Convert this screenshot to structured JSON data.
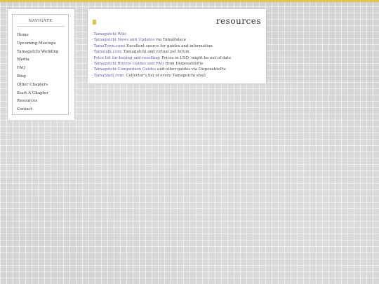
{
  "colors": {
    "accent": "#e2c64a",
    "link": "#5a5ab0",
    "heading_marker": "#d9c64e"
  },
  "nav": {
    "title": "NAVIGATE",
    "items": [
      {
        "label": "Home"
      },
      {
        "label": "Upcoming Meetups"
      },
      {
        "label": "Tamagotchi Wedding"
      },
      {
        "label": "Media"
      },
      {
        "label": "FAQ"
      },
      {
        "label": "Blog"
      },
      {
        "label": "Other Chapters"
      },
      {
        "label": "Start A Chapter"
      },
      {
        "label": "Resources"
      },
      {
        "label": "Contact"
      }
    ]
  },
  "main": {
    "title": "resources",
    "bullet": "-",
    "resources": [
      {
        "link": "Tamagotchi Wiki",
        "text": ""
      },
      {
        "link": "Tamagotchi News and Updates",
        "text": " via TamaPalace"
      },
      {
        "link": "TamaTown.com",
        "text": ": Excellent source for guides and information"
      },
      {
        "link": "Tamatalk.com",
        "text": ": Tamagotchi and virtual pet forum"
      },
      {
        "link": "Price list for buying and reselling",
        "text": ": Prices in USD, might be out of date"
      },
      {
        "link": "Tamagotchi Buyers Guides and FAQ",
        "text": " from DisposablePie"
      },
      {
        "link": "Tamagotchi Comparison Guides",
        "text": " and other guides via DisposablePie"
      },
      {
        "link": "TamaShell.com",
        "text": ": Collector's list of every Tamagotchi shell"
      }
    ]
  }
}
